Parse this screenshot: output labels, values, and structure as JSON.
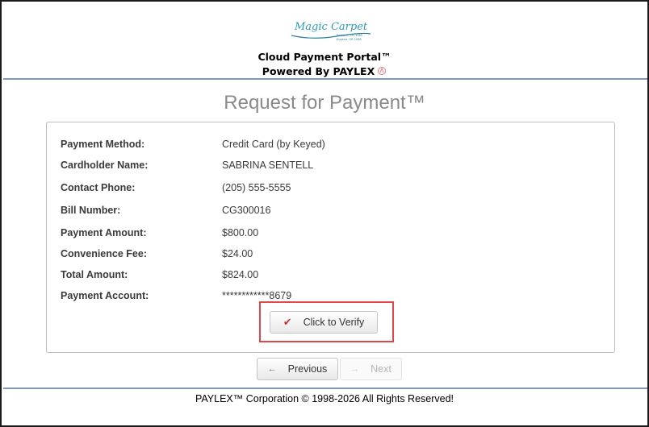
{
  "header": {
    "logo_text": "Magic Carpet",
    "logo_subtext": [
      "Portland, OR 1965",
      "Eugene, OR 1938"
    ],
    "portal_title": "Cloud Payment Portal™",
    "powered_by": "Powered By PAYLEX"
  },
  "main": {
    "title": "Request for Payment™",
    "details": [
      {
        "label": "Payment Method:",
        "value": "Credit Card (by Keyed)"
      },
      {
        "label": "Cardholder Name:",
        "value": "SABRINA SENTELL"
      },
      {
        "label": "Contact Phone:",
        "value": "(205) 555-5555"
      },
      {
        "label": "Bill Number:",
        "value": "CG300016"
      },
      {
        "label": "Payment Amount:",
        "value": "$800.00"
      },
      {
        "label": "Convenience Fee:",
        "value": "$24.00"
      },
      {
        "label": "Total Amount:",
        "value": "$824.00"
      },
      {
        "label": "Payment Account:",
        "value": "************8679"
      }
    ],
    "verify_button": {
      "label": "Click to Verify",
      "icon": "check-icon"
    },
    "highlight_color": "#e0474c"
  },
  "nav": {
    "previous_label": "Previous",
    "previous_icon": "arrow-left-icon",
    "next_label": "Next",
    "next_icon": "arrow-right-icon",
    "next_disabled": true
  },
  "footer": {
    "copyright": "PAYLEX™ Corporation © 1998-2026 All Rights Reserved!"
  },
  "colors": {
    "rule": "#7f96c8",
    "title_gray": "#8a8a8a",
    "check_red": "#c9302c"
  }
}
